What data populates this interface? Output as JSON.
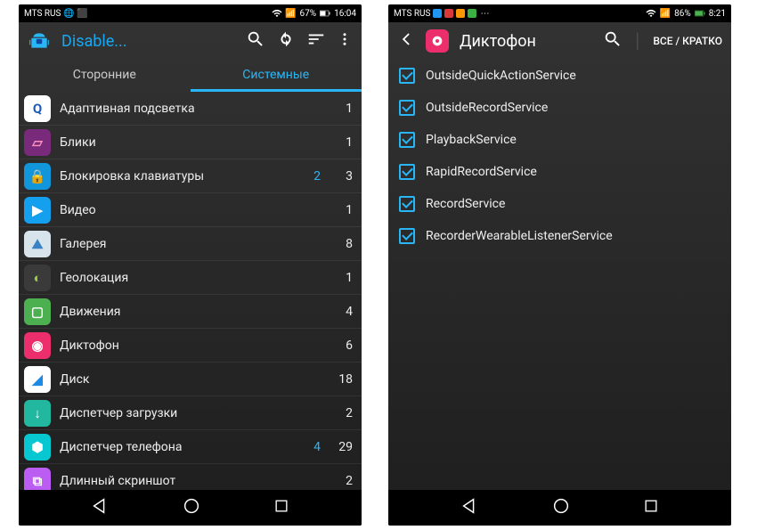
{
  "left": {
    "status": {
      "carrier": "MTS RUS",
      "signal": "",
      "battery_pct": "67%",
      "time": "16:04"
    },
    "action": {
      "title": "Disable..."
    },
    "tabs": {
      "third_party": "Сторонние",
      "system": "Системные",
      "active": 1
    },
    "apps": [
      {
        "name": "Адаптивная подсветка",
        "disabled": "",
        "count": "1",
        "icon": {
          "bg": "#fff",
          "glyph": "Q",
          "fg": "#1e5db6"
        }
      },
      {
        "name": "Блики",
        "disabled": "",
        "count": "1",
        "icon": {
          "bg": "#7a2a7a",
          "glyph": "▱",
          "fg": "#ff90c0"
        }
      },
      {
        "name": "Блокировка клавиатуры",
        "disabled": "2",
        "count": "3",
        "icon": {
          "bg": "#1296db",
          "glyph": "🔒",
          "fg": "#fff"
        }
      },
      {
        "name": "Видео",
        "disabled": "",
        "count": "1",
        "icon": {
          "bg": "#14a0ef",
          "glyph": "▶",
          "fg": "#fff"
        }
      },
      {
        "name": "Галерея",
        "disabled": "",
        "count": "8",
        "icon": {
          "bg": "#d7e4ec",
          "glyph": "⛰",
          "fg": "#3b82c4"
        }
      },
      {
        "name": "Геолокация",
        "disabled": "",
        "count": "1",
        "icon": {
          "bg": "#3a3a3a",
          "glyph": "◐",
          "fg": "#9ccc40"
        }
      },
      {
        "name": "Движения",
        "disabled": "",
        "count": "4",
        "icon": {
          "bg": "#4caf50",
          "glyph": "▢",
          "fg": "#fff"
        }
      },
      {
        "name": "Диктофон",
        "disabled": "",
        "count": "6",
        "icon": {
          "bg": "#ec2f6c",
          "glyph": "◉",
          "fg": "#fff"
        }
      },
      {
        "name": "Диск",
        "disabled": "",
        "count": "18",
        "icon": {
          "bg": "#fff",
          "glyph": "◢",
          "fg": "#1e88e5"
        }
      },
      {
        "name": "Диспетчер загрузки",
        "disabled": "",
        "count": "2",
        "icon": {
          "bg": "#22b8a0",
          "glyph": "↓",
          "fg": "#fff"
        }
      },
      {
        "name": "Диспетчер телефона",
        "disabled": "4",
        "count": "29",
        "icon": {
          "bg": "#07c7d0",
          "glyph": "⬢",
          "fg": "#fff"
        }
      },
      {
        "name": "Длинный скриншот",
        "disabled": "",
        "count": "2",
        "icon": {
          "bg": "#bb5cf2",
          "glyph": "⧉",
          "fg": "#fff"
        }
      }
    ]
  },
  "right": {
    "status": {
      "carrier": "MTS RUS",
      "battery_pct": "86%",
      "time": "8:21"
    },
    "action": {
      "title": "Диктофон",
      "toggle": "ВСЕ / КРАТКО"
    },
    "services": [
      {
        "name": "OutsideQuickActionService",
        "checked": true
      },
      {
        "name": "OutsideRecordService",
        "checked": true
      },
      {
        "name": "PlaybackService",
        "checked": true
      },
      {
        "name": "RapidRecordService",
        "checked": true
      },
      {
        "name": "RecordService",
        "checked": true
      },
      {
        "name": "RecorderWearableListenerService",
        "checked": true
      }
    ]
  }
}
